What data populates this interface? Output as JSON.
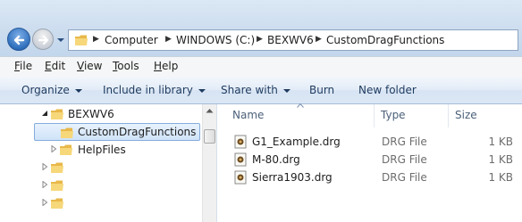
{
  "address": {
    "crumbs": [
      "Computer",
      "WINDOWS (C:)",
      "BEXWV6",
      "CustomDragFunctions"
    ]
  },
  "menu": {
    "items": [
      {
        "underline": "F",
        "rest": "ile"
      },
      {
        "underline": "E",
        "rest": "dit"
      },
      {
        "underline": "V",
        "rest": "iew"
      },
      {
        "underline": "T",
        "rest": "ools"
      },
      {
        "underline": "H",
        "rest": "elp"
      }
    ]
  },
  "commands": {
    "organize": "Organize",
    "include": "Include in library",
    "share": "Share with",
    "burn": "Burn",
    "new_folder": "New folder"
  },
  "tree": {
    "bexwv6": "BEXWV6",
    "custom": "CustomDragFunctions",
    "help": "HelpFiles"
  },
  "columns": {
    "name": "Name",
    "type": "Type",
    "size": "Size"
  },
  "files": [
    {
      "name": "G1_Example.drg",
      "type": "DRG File",
      "size": "1 KB"
    },
    {
      "name": "M-80.drg",
      "type": "DRG File",
      "size": "1 KB"
    },
    {
      "name": "Sierra1903.drg",
      "type": "DRG File",
      "size": "1 KB"
    }
  ],
  "colors": {
    "selection": "#cfe3f8",
    "folder": "#f2c94c",
    "command_text": "#1e3a5f"
  }
}
